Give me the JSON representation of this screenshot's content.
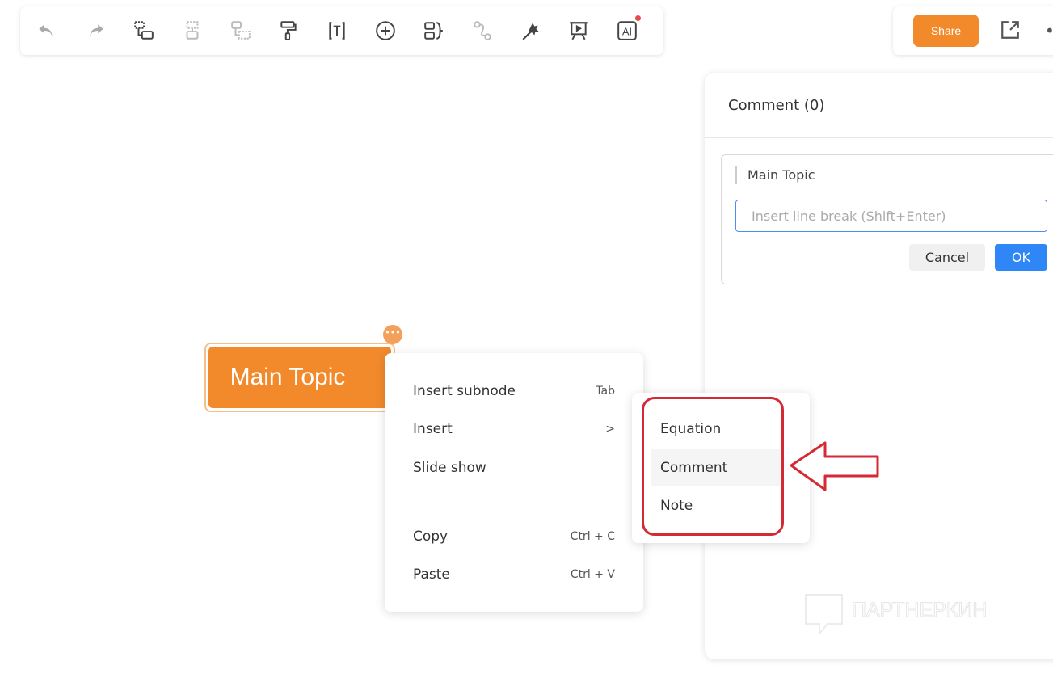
{
  "toolbar": {
    "items": [
      {
        "name": "undo-icon"
      },
      {
        "name": "redo-icon"
      },
      {
        "name": "subtopic-icon"
      },
      {
        "name": "sibling-topic-icon"
      },
      {
        "name": "floating-topic-icon"
      },
      {
        "name": "format-painter-icon"
      },
      {
        "name": "text-icon"
      },
      {
        "name": "insert-icon"
      },
      {
        "name": "summary-icon"
      },
      {
        "name": "relationship-icon"
      },
      {
        "name": "magic-icon"
      },
      {
        "name": "presentation-icon"
      },
      {
        "name": "ai-icon"
      }
    ]
  },
  "header": {
    "share_label": "Share",
    "more_label": "•"
  },
  "node": {
    "label": "Main Topic",
    "more_label": "•••"
  },
  "context_menu": {
    "items": [
      {
        "label": "Insert subnode",
        "shortcut": "Tab"
      },
      {
        "label": "Insert",
        "shortcut": ">"
      },
      {
        "label": "Slide show",
        "shortcut": ""
      },
      {
        "label": "Copy",
        "shortcut": "Ctrl + C"
      },
      {
        "label": "Paste",
        "shortcut": "Ctrl + V"
      }
    ]
  },
  "submenu": {
    "items": [
      {
        "label": "Equation"
      },
      {
        "label": "Comment"
      },
      {
        "label": "Note"
      }
    ]
  },
  "comment_panel": {
    "title": "Comment (0)",
    "topic": "Main Topic",
    "placeholder": "Insert line break (Shift+Enter)",
    "cancel_label": "Cancel",
    "ok_label": "OK"
  },
  "watermark": {
    "text": "ПАРТНЕРКИН"
  },
  "colors": {
    "accent": "#f28a2c",
    "primary": "#2f86f6",
    "annotation": "#d42a35"
  }
}
